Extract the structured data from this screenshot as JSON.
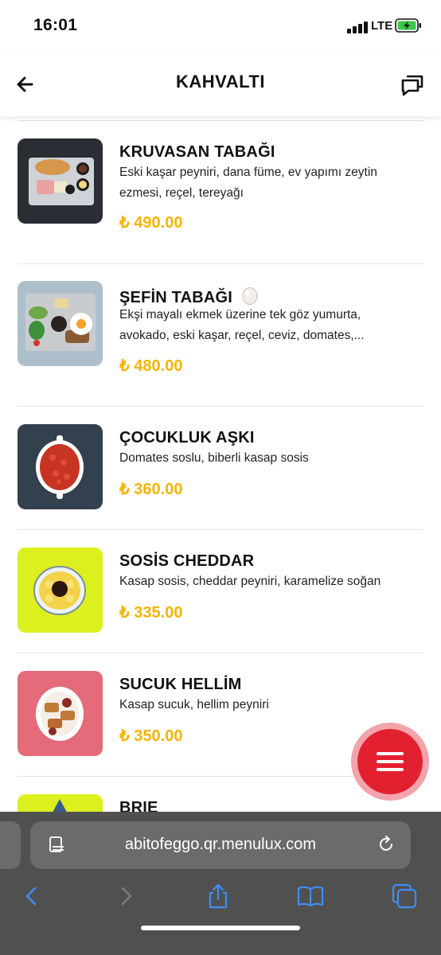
{
  "status": {
    "time": "16:01",
    "network": "LTE"
  },
  "header": {
    "title": "KAHVALTI"
  },
  "items": [
    {
      "name": "KRUVASAN TABAĞI",
      "desc": "Eski kaşar peyniri, dana füme, ev yapımı zeytin ezmesi, reçel, tereyağı",
      "price": "₺ 490.00",
      "thumb_bg": "#2a2d33"
    },
    {
      "name": "ŞEFİN TABAĞI",
      "desc": "Ekşi mayalı ekmek üzerine tek göz yumurta, avokado, eski kaşar, reçel, ceviz, domates,...",
      "price": "₺ 480.00",
      "thumb_bg": "#9fb4c4",
      "icon": "egg-emoji"
    },
    {
      "name": "ÇOCUKLUK AŞKI",
      "desc": "Domates soslu, biberli kasap sosis",
      "price": "₺ 360.00",
      "thumb_bg": "#33404d"
    },
    {
      "name": "SOSİS CHEDDAR",
      "desc": "Kasap sosis, cheddar peyniri, karamelize soğan",
      "price": "₺ 335.00",
      "thumb_bg": "#dcf01e"
    },
    {
      "name": "SUCUK HELLİM",
      "desc": "Kasap sucuk, hellim peyniri",
      "price": "₺ 350.00",
      "thumb_bg": "#e56b7a"
    },
    {
      "name": "BRIE",
      "thumb_bg": "#dcf01e"
    }
  ],
  "browser": {
    "url": "abitofeggo.qr.menulux.com"
  },
  "colors": {
    "accent": "#e3202f",
    "price": "#f5b400"
  }
}
